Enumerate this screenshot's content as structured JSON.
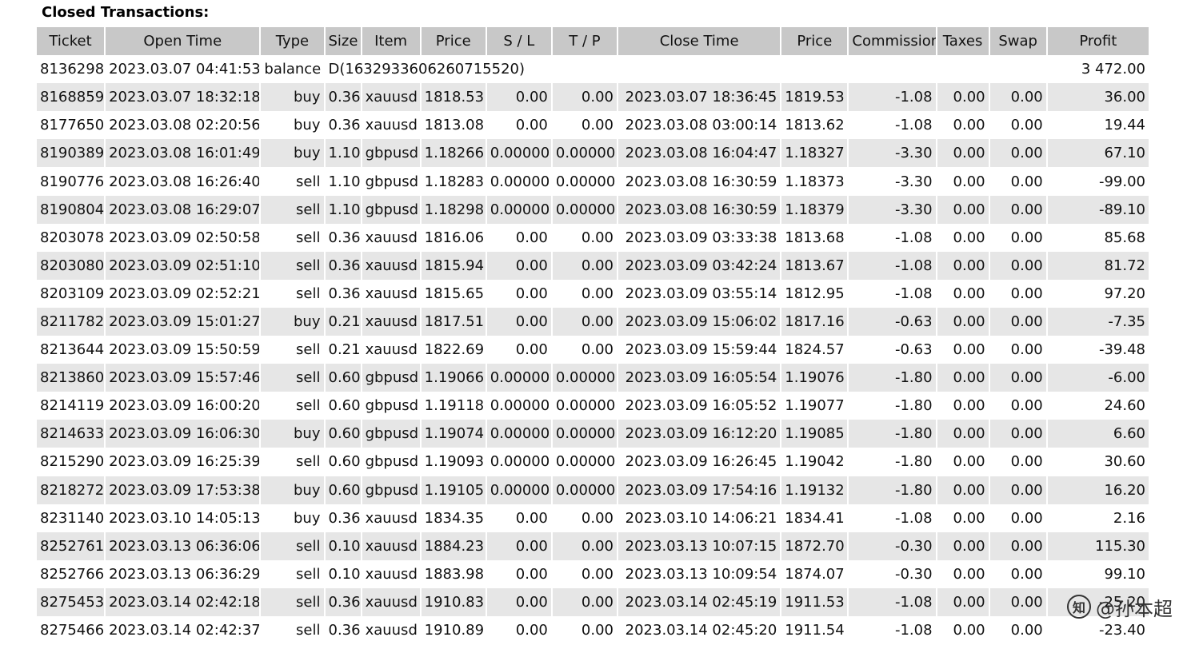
{
  "section_title": "Closed Transactions:",
  "columns": [
    "Ticket",
    "Open Time",
    "Type",
    "Size",
    "Item",
    "Price",
    "S / L",
    "T / P",
    "Close Time",
    "Price",
    "Commission",
    "Taxes",
    "Swap",
    "Profit"
  ],
  "balance_row": {
    "ticket": "8136298",
    "open_time": "2023.03.07 04:41:53",
    "type": "balance",
    "comment": "D(1632933606260715520)",
    "profit": "3 472.00"
  },
  "rows": [
    [
      "8168859",
      "2023.03.07 18:32:18",
      "buy",
      "0.36",
      "xauusd",
      "1818.53",
      "0.00",
      "0.00",
      "2023.03.07 18:36:45",
      "1819.53",
      "-1.08",
      "0.00",
      "0.00",
      "36.00"
    ],
    [
      "8177650",
      "2023.03.08 02:20:56",
      "buy",
      "0.36",
      "xauusd",
      "1813.08",
      "0.00",
      "0.00",
      "2023.03.08 03:00:14",
      "1813.62",
      "-1.08",
      "0.00",
      "0.00",
      "19.44"
    ],
    [
      "8190389",
      "2023.03.08 16:01:49",
      "buy",
      "1.10",
      "gbpusd",
      "1.18266",
      "0.00000",
      "0.00000",
      "2023.03.08 16:04:47",
      "1.18327",
      "-3.30",
      "0.00",
      "0.00",
      "67.10"
    ],
    [
      "8190776",
      "2023.03.08 16:26:40",
      "sell",
      "1.10",
      "gbpusd",
      "1.18283",
      "0.00000",
      "0.00000",
      "2023.03.08 16:30:59",
      "1.18373",
      "-3.30",
      "0.00",
      "0.00",
      "-99.00"
    ],
    [
      "8190804",
      "2023.03.08 16:29:07",
      "sell",
      "1.10",
      "gbpusd",
      "1.18298",
      "0.00000",
      "0.00000",
      "2023.03.08 16:30:59",
      "1.18379",
      "-3.30",
      "0.00",
      "0.00",
      "-89.10"
    ],
    [
      "8203078",
      "2023.03.09 02:50:58",
      "sell",
      "0.36",
      "xauusd",
      "1816.06",
      "0.00",
      "0.00",
      "2023.03.09 03:33:38",
      "1813.68",
      "-1.08",
      "0.00",
      "0.00",
      "85.68"
    ],
    [
      "8203080",
      "2023.03.09 02:51:10",
      "sell",
      "0.36",
      "xauusd",
      "1815.94",
      "0.00",
      "0.00",
      "2023.03.09 03:42:24",
      "1813.67",
      "-1.08",
      "0.00",
      "0.00",
      "81.72"
    ],
    [
      "8203109",
      "2023.03.09 02:52:21",
      "sell",
      "0.36",
      "xauusd",
      "1815.65",
      "0.00",
      "0.00",
      "2023.03.09 03:55:14",
      "1812.95",
      "-1.08",
      "0.00",
      "0.00",
      "97.20"
    ],
    [
      "8211782",
      "2023.03.09 15:01:27",
      "buy",
      "0.21",
      "xauusd",
      "1817.51",
      "0.00",
      "0.00",
      "2023.03.09 15:06:02",
      "1817.16",
      "-0.63",
      "0.00",
      "0.00",
      "-7.35"
    ],
    [
      "8213644",
      "2023.03.09 15:50:59",
      "sell",
      "0.21",
      "xauusd",
      "1822.69",
      "0.00",
      "0.00",
      "2023.03.09 15:59:44",
      "1824.57",
      "-0.63",
      "0.00",
      "0.00",
      "-39.48"
    ],
    [
      "8213860",
      "2023.03.09 15:57:46",
      "sell",
      "0.60",
      "gbpusd",
      "1.19066",
      "0.00000",
      "0.00000",
      "2023.03.09 16:05:54",
      "1.19076",
      "-1.80",
      "0.00",
      "0.00",
      "-6.00"
    ],
    [
      "8214119",
      "2023.03.09 16:00:20",
      "sell",
      "0.60",
      "gbpusd",
      "1.19118",
      "0.00000",
      "0.00000",
      "2023.03.09 16:05:52",
      "1.19077",
      "-1.80",
      "0.00",
      "0.00",
      "24.60"
    ],
    [
      "8214633",
      "2023.03.09 16:06:30",
      "buy",
      "0.60",
      "gbpusd",
      "1.19074",
      "0.00000",
      "0.00000",
      "2023.03.09 16:12:20",
      "1.19085",
      "-1.80",
      "0.00",
      "0.00",
      "6.60"
    ],
    [
      "8215290",
      "2023.03.09 16:25:39",
      "sell",
      "0.60",
      "gbpusd",
      "1.19093",
      "0.00000",
      "0.00000",
      "2023.03.09 16:26:45",
      "1.19042",
      "-1.80",
      "0.00",
      "0.00",
      "30.60"
    ],
    [
      "8218272",
      "2023.03.09 17:53:38",
      "buy",
      "0.60",
      "gbpusd",
      "1.19105",
      "0.00000",
      "0.00000",
      "2023.03.09 17:54:16",
      "1.19132",
      "-1.80",
      "0.00",
      "0.00",
      "16.20"
    ],
    [
      "8231140",
      "2023.03.10 14:05:13",
      "buy",
      "0.36",
      "xauusd",
      "1834.35",
      "0.00",
      "0.00",
      "2023.03.10 14:06:21",
      "1834.41",
      "-1.08",
      "0.00",
      "0.00",
      "2.16"
    ],
    [
      "8252761",
      "2023.03.13 06:36:06",
      "sell",
      "0.10",
      "xauusd",
      "1884.23",
      "0.00",
      "0.00",
      "2023.03.13 10:07:15",
      "1872.70",
      "-0.30",
      "0.00",
      "0.00",
      "115.30"
    ],
    [
      "8252766",
      "2023.03.13 06:36:29",
      "sell",
      "0.10",
      "xauusd",
      "1883.98",
      "0.00",
      "0.00",
      "2023.03.13 10:09:54",
      "1874.07",
      "-0.30",
      "0.00",
      "0.00",
      "99.10"
    ],
    [
      "8275453",
      "2023.03.14 02:42:18",
      "sell",
      "0.36",
      "xauusd",
      "1910.83",
      "0.00",
      "0.00",
      "2023.03.14 02:45:19",
      "1911.53",
      "-1.08",
      "0.00",
      "0.00",
      "-25.20"
    ],
    [
      "8275466",
      "2023.03.14 02:42:37",
      "sell",
      "0.36",
      "xauusd",
      "1910.89",
      "0.00",
      "0.00",
      "2023.03.14 02:45:20",
      "1911.54",
      "-1.08",
      "0.00",
      "0.00",
      "-23.40"
    ]
  ],
  "watermark": {
    "icon": "zhihu-logo-icon",
    "glyph": "知",
    "text": "@孙本超"
  }
}
